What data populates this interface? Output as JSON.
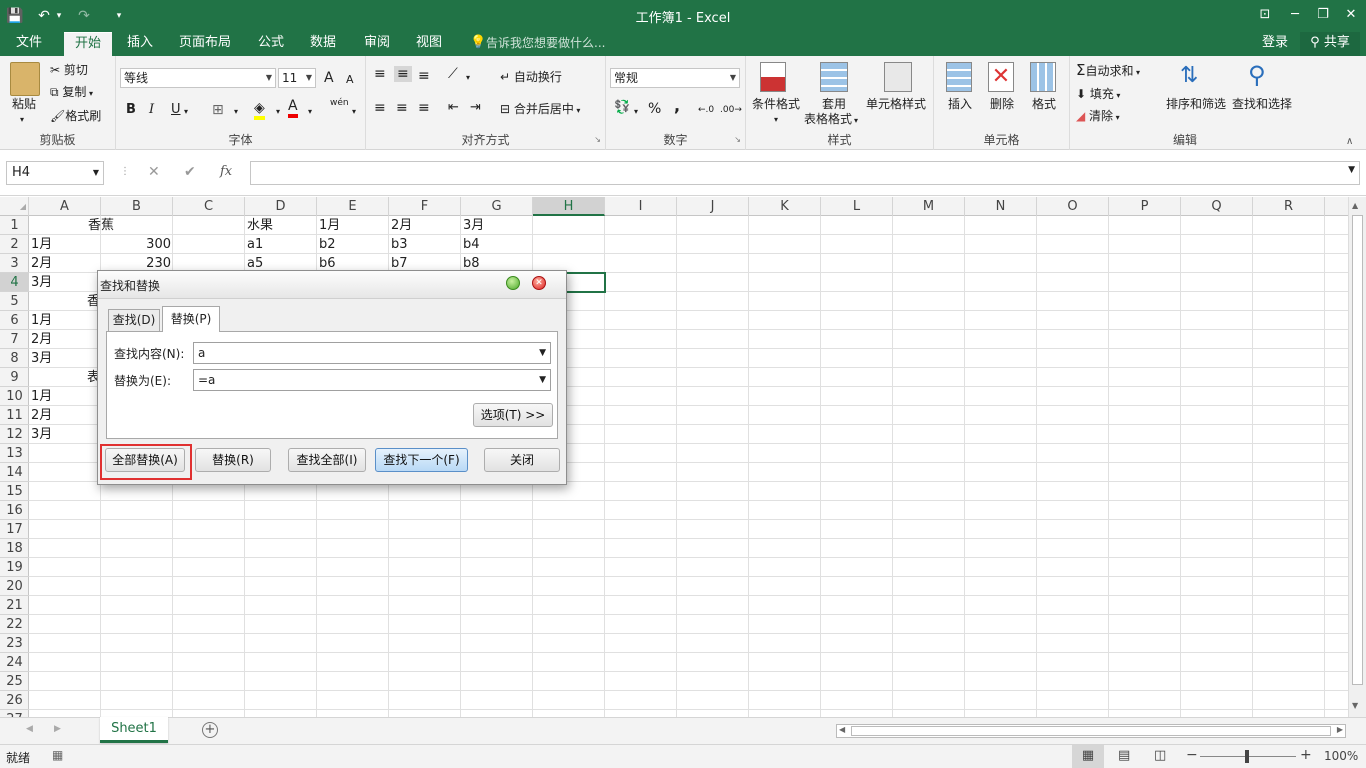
{
  "window": {
    "title": "工作簿1 - Excel",
    "min": "─",
    "max": "❐",
    "close": "✕",
    "ribbon_opts": "⊡"
  },
  "quick_access": {
    "save": "💾",
    "undo": "↶",
    "redo": "↷",
    "more": "▾"
  },
  "ribbon_tabs": [
    "文件",
    "开始",
    "插入",
    "页面布局",
    "公式",
    "数据",
    "审阅",
    "视图"
  ],
  "tell_me": "告诉我您想要做什么...",
  "account": {
    "login": "登录",
    "share": "共享"
  },
  "clipboard": {
    "paste": "粘贴",
    "cut": "剪切",
    "copy": "复制",
    "format_painter": "格式刷",
    "label": "剪贴板"
  },
  "font": {
    "name": "等线",
    "size": "11",
    "bold": "B",
    "italic": "I",
    "underline": "U",
    "grow": "A",
    "shrink": "A",
    "label": "字体",
    "phonetic": "wén"
  },
  "alignment": {
    "wrap": "自动换行",
    "merge": "合并后居中",
    "label": "对齐方式"
  },
  "number": {
    "format": "常规",
    "percent": "%",
    "comma": ",",
    "label": "数字"
  },
  "styles": {
    "conditional": "条件格式",
    "table_line1": "套用",
    "table_line2": "表格格式",
    "cell_styles": "单元格样式",
    "label": "样式"
  },
  "cells_group": {
    "insert": "插入",
    "delete": "删除",
    "format": "格式",
    "label": "单元格"
  },
  "editing": {
    "autosum": "自动求和",
    "fill": "填充",
    "clear": "清除",
    "sort": "排序和筛选",
    "find": "查找和选择",
    "label": "编辑"
  },
  "formula_bar": {
    "name_box": "H4",
    "cancel": "✕",
    "enter": "✔",
    "fx": "fx",
    "value": ""
  },
  "columns": [
    "A",
    "B",
    "C",
    "D",
    "E",
    "F",
    "G",
    "H",
    "I",
    "J",
    "K",
    "L",
    "M",
    "N",
    "O",
    "P",
    "Q",
    "R"
  ],
  "rows": [
    "1",
    "2",
    "3",
    "4",
    "5",
    "6",
    "7",
    "8",
    "9",
    "10",
    "11",
    "12",
    "13",
    "14",
    "15",
    "16",
    "17",
    "18",
    "19",
    "20",
    "21",
    "22",
    "23",
    "24",
    "25",
    "26",
    "27"
  ],
  "cells": {
    "B1": "香蕉",
    "D1": "水果",
    "E1": "1月",
    "F1": "2月",
    "G1": "3月",
    "A2": "1月",
    "B2": "300",
    "D2": "a1",
    "E2": "b2",
    "F2": "b3",
    "G2": "b4",
    "A3": "2月",
    "B3": "230",
    "D3": "a5",
    "E3": "b6",
    "F3": "b7",
    "G3": "b8",
    "A4": "3月",
    "B5": "香",
    "A6": "1月",
    "A7": "2月",
    "A8": "3月",
    "B9": "表",
    "A10": "1月",
    "A11": "2月",
    "A12": "3月"
  },
  "dialog": {
    "title": "查找和替换",
    "tab_find": "查找(D)",
    "tab_replace": "替换(P)",
    "find_label": "查找内容(N):",
    "find_value": "a",
    "replace_label": "替换为(E):",
    "replace_value": "=a",
    "options": "选项(T) >>",
    "replace_all": "全部替换(A)",
    "replace": "替换(R)",
    "find_all": "查找全部(I)",
    "find_next": "查找下一个(F)",
    "close": "关闭"
  },
  "sheets": {
    "active": "Sheet1",
    "add": "+"
  },
  "status": {
    "ready": "就绪",
    "zoom": "100%",
    "minus": "−",
    "plus": "+"
  },
  "colors": {
    "excel_green": "#217346",
    "highlight_red": "#e03030",
    "find_next_blue": "#c7e0f8"
  }
}
